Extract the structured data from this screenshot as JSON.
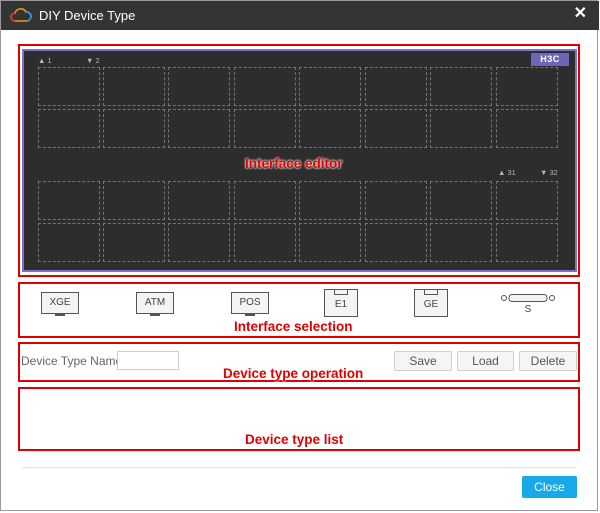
{
  "dialog": {
    "title": "DIY Device Type",
    "close_glyph": "✕",
    "title_icon": "cloud-logo-icon",
    "close_button_label": "Close"
  },
  "editor": {
    "region_label": "Interface editor",
    "logo_text": "H3C",
    "port_labels": {
      "top_left_1": "1",
      "top_left_2": "2",
      "right_31": "31",
      "right_32": "32"
    }
  },
  "selection": {
    "region_label": "Interface selection",
    "types": [
      "XGE",
      "ATM",
      "POS",
      "E1",
      "GE",
      "S"
    ]
  },
  "operation": {
    "region_label": "Device type operation",
    "name_label": "Device Type Name",
    "name_value": "",
    "save_label": "Save",
    "load_label": "Load",
    "delete_label": "Delete"
  },
  "list": {
    "region_label": "Device type list"
  },
  "colors": {
    "annotation": "#e00000",
    "board": "#2d2d2d",
    "board_border": "#7a73c6",
    "primary_button": "#19a9e8"
  }
}
